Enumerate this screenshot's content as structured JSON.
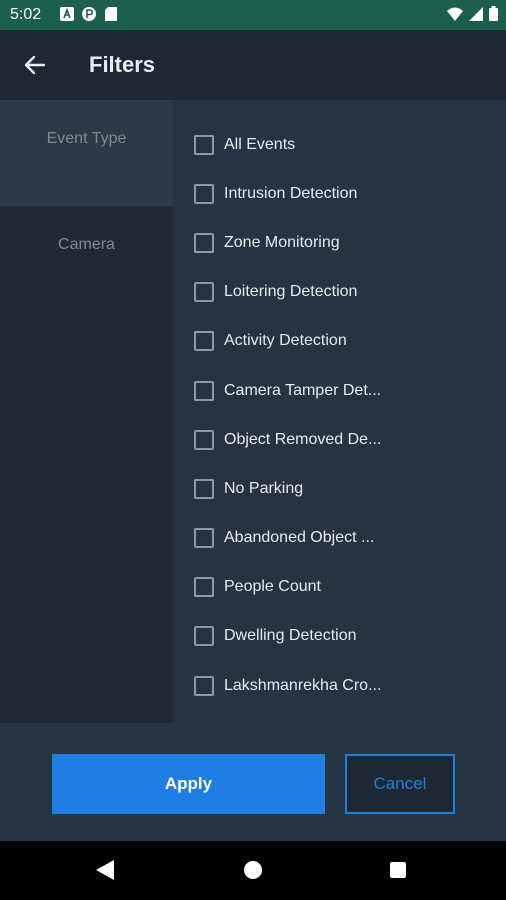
{
  "status_bar": {
    "time": "5:02",
    "left_icons": [
      "a-icon",
      "p-icon",
      "sd-card-icon"
    ],
    "right_icons": [
      "wifi-icon",
      "signal-icon",
      "battery-icon"
    ]
  },
  "app_bar": {
    "title": "Filters",
    "back_icon": "arrow-left-icon"
  },
  "left_tabs": [
    {
      "label": "Event Type",
      "selected": true
    },
    {
      "label": "Camera",
      "selected": false
    }
  ],
  "event_types": [
    {
      "label": "All Events",
      "checked": false
    },
    {
      "label": "Intrusion Detection",
      "checked": false
    },
    {
      "label": "Zone Monitoring",
      "checked": false
    },
    {
      "label": "Loitering Detection",
      "checked": false
    },
    {
      "label": "Activity Detection",
      "checked": false
    },
    {
      "label": "Camera Tamper Det...",
      "checked": false
    },
    {
      "label": "Object Removed De...",
      "checked": false
    },
    {
      "label": "No Parking",
      "checked": false
    },
    {
      "label": "Abandoned Object ...",
      "checked": false
    },
    {
      "label": "People Count",
      "checked": false
    },
    {
      "label": "Dwelling Detection",
      "checked": false
    },
    {
      "label": "Lakshmanrekha Cro...",
      "checked": false
    }
  ],
  "actions": {
    "apply": "Apply",
    "cancel": "Cancel"
  },
  "colors": {
    "accent": "#1f7ee3",
    "status_bar": "#1c5f4d",
    "background": "#263340"
  }
}
